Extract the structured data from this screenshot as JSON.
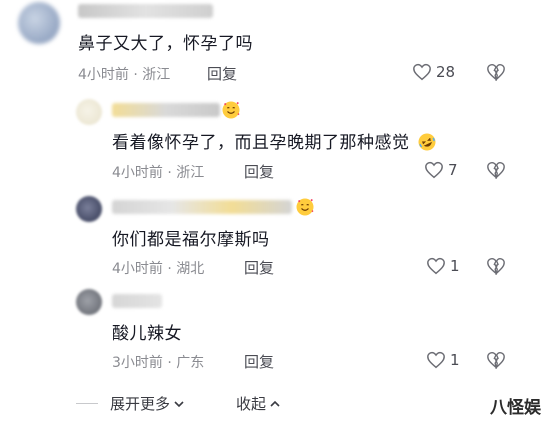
{
  "comments": [
    {
      "text": "鼻子又大了，怀孕了吗",
      "time": "4小时前",
      "location": "浙江",
      "reply_label": "回复",
      "likes": "28"
    },
    {
      "text": "看着像怀孕了，而且孕晚期了那种感觉",
      "time": "4小时前",
      "location": "浙江",
      "reply_label": "回复",
      "likes": "7"
    },
    {
      "text": "你们都是福尔摩斯吗",
      "time": "4小时前",
      "location": "湖北",
      "reply_label": "回复",
      "likes": "1"
    },
    {
      "text": "酸儿辣女",
      "time": "3小时前",
      "location": "广东",
      "reply_label": "回复",
      "likes": "1"
    }
  ],
  "separator": "·",
  "footer": {
    "expand_label": "展开更多",
    "collapse_label": "收起"
  },
  "watermark": "八怪娱",
  "icons": {
    "like": "heart-outline-icon",
    "dislike": "broken-heart-icon",
    "expand": "chevron-down-icon",
    "collapse": "chevron-up-icon",
    "emoji_love": "smiling-face-with-hearts-icon",
    "emoji_laugh": "rolling-on-floor-laughing-icon"
  },
  "colors": {
    "text": "#161823",
    "meta": "#8a8b91",
    "icon": "#6b6c73",
    "watermark": "#2b2b2b"
  }
}
